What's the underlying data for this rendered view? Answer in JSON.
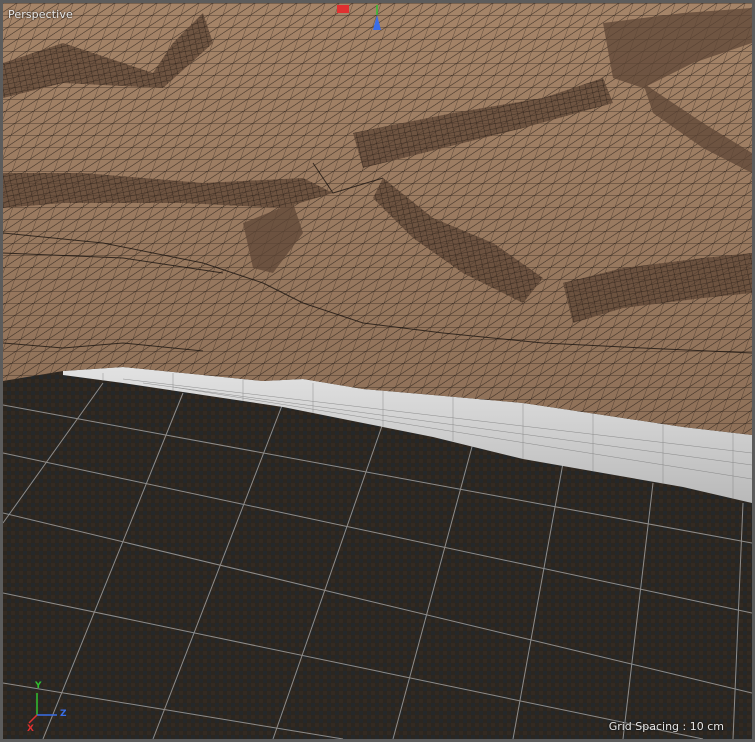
{
  "viewport": {
    "view_name": "Perspective",
    "grid_spacing": "Grid Spacing : 10 cm"
  },
  "axis": {
    "x_label": "X",
    "y_label": "Y",
    "z_label": "Z",
    "x_color": "#e03030",
    "y_color": "#30c030",
    "z_color": "#3a6ee8"
  },
  "colors": {
    "terrain": "#9a7a62",
    "terrain_dark": "#6e5442",
    "wire": "#1a1410",
    "floor_grid": "#b8b8b8",
    "floor_bg": "#2a2620",
    "border": "#5c5c5c",
    "edge": "#d4d4d4"
  },
  "icons": [
    "axis-gizmo-icon",
    "x-axis-marker-icon",
    "z-axis-marker-icon"
  ]
}
